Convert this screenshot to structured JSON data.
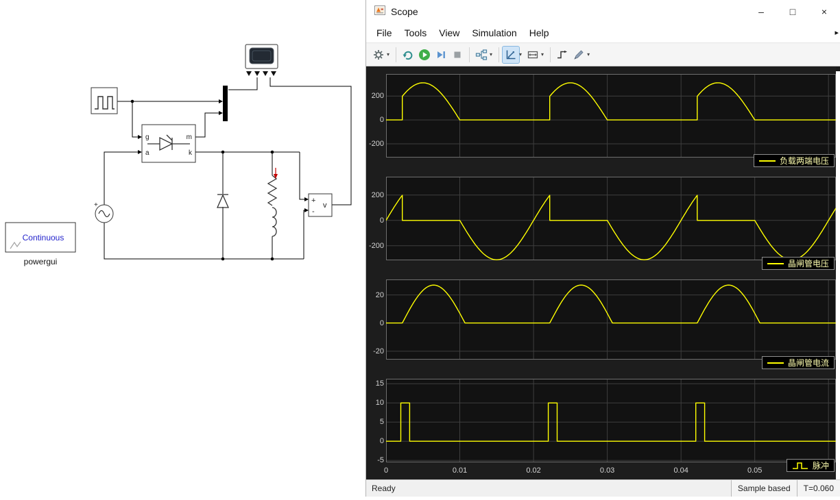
{
  "window": {
    "title": "Scope",
    "minimize_glyph": "–",
    "maximize_glyph": "□",
    "close_glyph": "×"
  },
  "menu": {
    "items": [
      "File",
      "Tools",
      "View",
      "Simulation",
      "Help"
    ],
    "overflow_glyph": "▸"
  },
  "toolbar": {
    "icons": [
      "settings-gear",
      "snapshot",
      "run",
      "step-forward",
      "stop",
      "signal-selector",
      "scale-axes",
      "zoom-fit",
      "trigger",
      "measurements"
    ]
  },
  "status": {
    "ready": "Ready",
    "sample": "Sample based",
    "time": "T=0.060"
  },
  "canvas": {
    "powergui_title": "Continuous",
    "powergui_label": "powergui",
    "ports": {
      "g": "g",
      "a": "a",
      "m": "m",
      "k": "k"
    },
    "vm": {
      "plus": "+",
      "minus": "-",
      "v": "v"
    },
    "source_plus": "+"
  },
  "chart_data": [
    {
      "type": "line",
      "title": "",
      "legend": "负载两端电压",
      "legend_glyph": "line",
      "color": "#ffff00",
      "xlim": [
        0,
        0.061
      ],
      "ylim": [
        -315,
        385
      ],
      "yticks": [
        200,
        0,
        -200
      ],
      "xticks": [
        0,
        0.01,
        0.02,
        0.03,
        0.04,
        0.05,
        0.06
      ],
      "segments": [
        {
          "kind": "flat",
          "t0": 0,
          "t1": 0.0022,
          "v": 0
        },
        {
          "kind": "sine",
          "t0": 0.0022,
          "t1": 0.01,
          "amp": 311,
          "period": 0.02,
          "tref": 0
        },
        {
          "kind": "flat",
          "t0": 0.01,
          "t1": 0.0222,
          "v": 0
        },
        {
          "kind": "sine",
          "t0": 0.0222,
          "t1": 0.03,
          "amp": 311,
          "period": 0.02,
          "tref": 0.02
        },
        {
          "kind": "flat",
          "t0": 0.03,
          "t1": 0.0422,
          "v": 0
        },
        {
          "kind": "sine",
          "t0": 0.0422,
          "t1": 0.05,
          "amp": 311,
          "period": 0.02,
          "tref": 0.04
        },
        {
          "kind": "flat",
          "t0": 0.05,
          "t1": 0.061,
          "v": 0
        }
      ]
    },
    {
      "type": "line",
      "title": "",
      "legend": "晶闸管电压",
      "legend_glyph": "line",
      "color": "#ffff00",
      "xlim": [
        0,
        0.061
      ],
      "ylim": [
        -315,
        345
      ],
      "yticks": [
        200,
        0,
        -200
      ],
      "xticks": [
        0,
        0.01,
        0.02,
        0.03,
        0.04,
        0.05,
        0.06
      ],
      "segments": [
        {
          "kind": "sine",
          "t0": 0,
          "t1": 0.0022,
          "amp": 311,
          "period": 0.02,
          "tref": 0
        },
        {
          "kind": "flat",
          "t0": 0.0022,
          "t1": 0.01,
          "v": 0
        },
        {
          "kind": "sine",
          "t0": 0.01,
          "t1": 0.02,
          "amp": 311,
          "period": 0.02,
          "tref": 0
        },
        {
          "kind": "sine",
          "t0": 0.02,
          "t1": 0.0222,
          "amp": 311,
          "period": 0.02,
          "tref": 0.02
        },
        {
          "kind": "flat",
          "t0": 0.0222,
          "t1": 0.03,
          "v": 0
        },
        {
          "kind": "sine",
          "t0": 0.03,
          "t1": 0.04,
          "amp": 311,
          "period": 0.02,
          "tref": 0.02
        },
        {
          "kind": "sine",
          "t0": 0.04,
          "t1": 0.0422,
          "amp": 311,
          "period": 0.02,
          "tref": 0.04
        },
        {
          "kind": "flat",
          "t0": 0.0422,
          "t1": 0.05,
          "v": 0
        },
        {
          "kind": "sine",
          "t0": 0.05,
          "t1": 0.06,
          "amp": 311,
          "period": 0.02,
          "tref": 0.04
        },
        {
          "kind": "sine",
          "t0": 0.06,
          "t1": 0.061,
          "amp": 311,
          "period": 0.02,
          "tref": 0.06
        }
      ]
    },
    {
      "type": "line",
      "title": "",
      "legend": "晶闸管电流",
      "legend_glyph": "line",
      "color": "#ffff00",
      "xlim": [
        0,
        0.061
      ],
      "ylim": [
        -26,
        31
      ],
      "yticks": [
        20,
        0,
        -20
      ],
      "xticks": [
        0,
        0.01,
        0.02,
        0.03,
        0.04,
        0.05,
        0.06
      ],
      "segments": [
        {
          "kind": "flat",
          "t0": 0,
          "t1": 0.0022,
          "v": 0
        },
        {
          "kind": "halfsine",
          "t0": 0.0022,
          "t1": 0.0107,
          "amp": 27
        },
        {
          "kind": "flat",
          "t0": 0.0107,
          "t1": 0.0222,
          "v": 0
        },
        {
          "kind": "halfsine",
          "t0": 0.0222,
          "t1": 0.0307,
          "amp": 27
        },
        {
          "kind": "flat",
          "t0": 0.0307,
          "t1": 0.0422,
          "v": 0
        },
        {
          "kind": "halfsine",
          "t0": 0.0422,
          "t1": 0.0507,
          "amp": 27
        },
        {
          "kind": "flat",
          "t0": 0.0507,
          "t1": 0.061,
          "v": 0
        }
      ]
    },
    {
      "type": "line",
      "title": "",
      "legend": "脉冲",
      "legend_glyph": "step",
      "color": "#ffff00",
      "xlim": [
        0,
        0.061
      ],
      "ylim": [
        -5.5,
        16.3
      ],
      "yticks": [
        15,
        10,
        5,
        0,
        -5
      ],
      "xticks": [
        0,
        0.01,
        0.02,
        0.03,
        0.04,
        0.05,
        0.06
      ],
      "xtick_labels": [
        "0",
        "0.01",
        "0.02",
        "0.03",
        "0.04",
        "0.05"
      ],
      "segments": [
        {
          "kind": "flat",
          "t0": 0,
          "t1": 0.002,
          "v": 0
        },
        {
          "kind": "flat",
          "t0": 0.002,
          "t1": 0.0032,
          "v": 10
        },
        {
          "kind": "flat",
          "t0": 0.0032,
          "t1": 0.022,
          "v": 0
        },
        {
          "kind": "flat",
          "t0": 0.022,
          "t1": 0.0232,
          "v": 10
        },
        {
          "kind": "flat",
          "t0": 0.0232,
          "t1": 0.042,
          "v": 0
        },
        {
          "kind": "flat",
          "t0": 0.042,
          "t1": 0.0432,
          "v": 10
        },
        {
          "kind": "flat",
          "t0": 0.0432,
          "t1": 0.061,
          "v": 0
        }
      ]
    }
  ]
}
